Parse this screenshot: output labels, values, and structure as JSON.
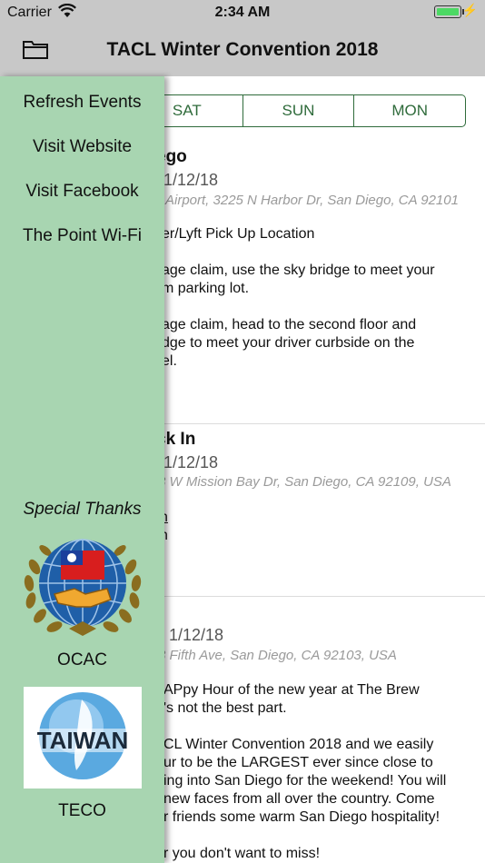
{
  "status": {
    "carrier": "Carrier",
    "time": "2:34 AM"
  },
  "nav": {
    "title": "TACL Winter Convention 2018"
  },
  "days": [
    "SAT",
    "SUN",
    "MON"
  ],
  "events": [
    {
      "title": "ego",
      "date": "1/12/18",
      "location": "Airport, 3225 N Harbor Dr, San Diego, CA 92101",
      "lines": [
        "er/Lyft Pick Up Location",
        "",
        "age claim, use the sky bridge to meet your",
        "m parking lot.",
        "",
        "age claim, head to the second floor and",
        "dge to meet your driver curbside on the",
        "el."
      ]
    },
    {
      "title": "ck In",
      "date": "1/12/18",
      "location": "3 W Mission Bay Dr, San Diego, CA 92109, USA",
      "lines": [
        "n",
        "n"
      ]
    },
    {
      "title": "",
      "date": "1/12/18",
      "location": "3 Fifth Ave, San Diego, CA 92103, USA",
      "lines": [
        "APpy Hour of the new year at The Brew",
        "'s not the best part.",
        "",
        "CL Winter Convention 2018 and we easily",
        "ur to be the LARGEST ever since close to",
        "ing into San Diego for the weekend! You will",
        "new faces from all over the country. Come",
        "r friends some warm San Diego hospitality!",
        "",
        "r you don't want to miss!"
      ]
    }
  ],
  "drawer": {
    "menu": [
      "Refresh Events",
      "Visit Website",
      "Visit Facebook",
      "The Point Wi-Fi"
    ],
    "thanks": "Special Thanks",
    "logos": [
      {
        "caption": "OCAC"
      },
      {
        "caption": "TECO",
        "text": "TAIWAN"
      }
    ]
  }
}
